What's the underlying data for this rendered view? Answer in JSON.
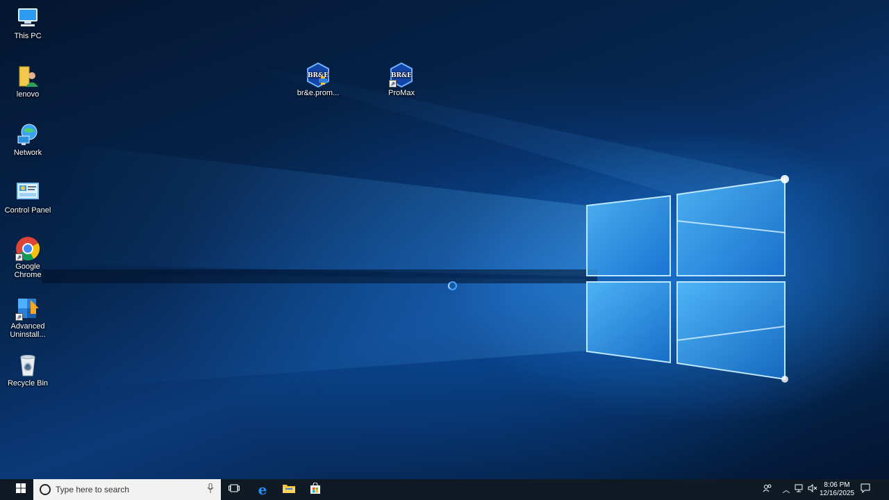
{
  "desktop": {
    "icons": [
      {
        "label": "This PC",
        "icon": "computer-icon",
        "shortcut": false
      },
      {
        "label": "lenovo",
        "icon": "user-folder-icon",
        "shortcut": false
      },
      {
        "label": "Network",
        "icon": "network-icon",
        "shortcut": false
      },
      {
        "label": "Control Panel",
        "icon": "control-panel-icon",
        "shortcut": false
      },
      {
        "label": "Google Chrome",
        "icon": "chrome-icon",
        "shortcut": true
      },
      {
        "label": "Advanced Uninstall...",
        "icon": "uninstaller-icon",
        "shortcut": true
      },
      {
        "label": "Recycle Bin",
        "icon": "recycle-bin-icon",
        "shortcut": false
      },
      {
        "label": "br&e.prom...",
        "icon": "bre-installer-icon",
        "shortcut": false,
        "badge_text": "BR&E"
      },
      {
        "label": "ProMax",
        "icon": "bre-promax-icon",
        "shortcut": true,
        "badge_text": "BR&E"
      }
    ]
  },
  "taskbar": {
    "search_placeholder": "Type here to search",
    "pinned": [
      "task-view-icon",
      "edge-icon",
      "file-explorer-icon",
      "store-icon"
    ],
    "tray": {
      "time": "8:06 PM",
      "date": "12/16/2025"
    }
  },
  "colors": {
    "taskbar_bg": "#101a24",
    "accent": "#1e90ff",
    "search_bg": "#f2f2f2"
  }
}
